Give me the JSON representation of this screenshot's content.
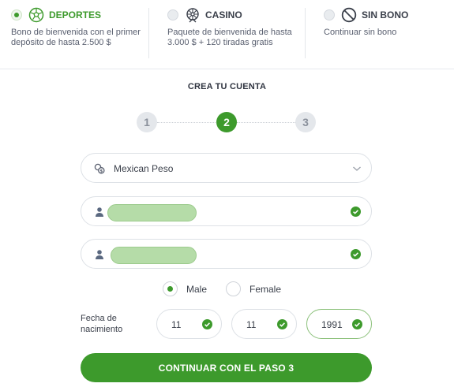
{
  "bonuses": [
    {
      "title": "DEPORTES",
      "description": "Bono de bienvenida con el primer depósito de hasta 2.500 $",
      "selected": true,
      "icon": "soccer-ball-icon"
    },
    {
      "title": "CASINO",
      "description": "Paquete de bienvenida de hasta 3.000 $ + 120 tiradas gratis",
      "selected": false,
      "icon": "ferris-wheel-icon"
    },
    {
      "title": "SIN BONO",
      "description": "Continuar sin bono",
      "selected": false,
      "icon": "no-entry-icon"
    }
  ],
  "form": {
    "heading": "CREA TU CUENTA",
    "steps": [
      "1",
      "2",
      "3"
    ],
    "current_step": 2,
    "currency": {
      "value": "Mexican Peso",
      "icon": "money-bag-icon"
    },
    "first_name": {
      "icon": "user-icon",
      "valid": true
    },
    "last_name": {
      "icon": "user-icon",
      "valid": true
    },
    "gender": {
      "options": [
        "Male",
        "Female"
      ],
      "selected": "Male"
    },
    "birth_date": {
      "label": "Fecha de nacimiento",
      "day": "11",
      "month": "11",
      "year": "1991"
    },
    "submit_label": "CONTINUAR CON EL PASO 3"
  },
  "colors": {
    "accent": "#3d9a2c",
    "masked_fill": "#b5dca8",
    "border": "#dde1e6"
  }
}
